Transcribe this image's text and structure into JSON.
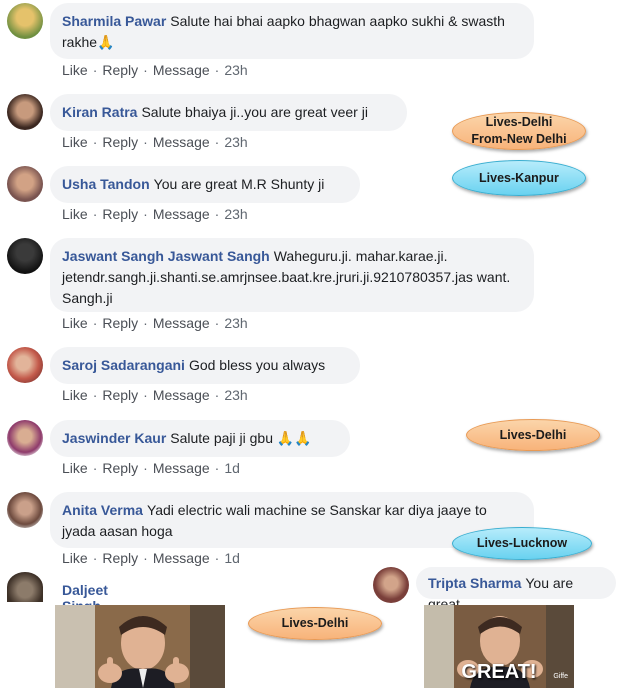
{
  "comments": [
    {
      "name": "Sharmila Pawar",
      "text": "Salute hai bhai aapko bhagwan aapko sukhi & swasth rakhe",
      "emoji": "🙏",
      "time": "23h"
    },
    {
      "name": "Kiran Ratra",
      "text": "Salute bhaiya ji..you are great veer ji",
      "time": "23h"
    },
    {
      "name": "Usha Tandon",
      "text": "You are great M.R Shunty ji",
      "time": "23h"
    },
    {
      "name": "Jaswant Sangh Jaswant Sangh",
      "text": "Waheguru.ji. mahar.karae.ji. jetendr.sangh.ji.shanti.se.amrjnsee.baat.kre.jruri.ji.9210780357.jas want. Sangh.ji",
      "time": "23h"
    },
    {
      "name": "Saroj Sadarangani",
      "text": "God bless you always",
      "time": "23h"
    },
    {
      "name": "Jaswinder Kaur",
      "text": "Salute paji ji gbu",
      "emoji": "🙏🙏",
      "time": "1d"
    },
    {
      "name": "Anita Verma",
      "text": "Yadi electric wali machine se Sanskar kar diya jaaye to jyada aasan hoga",
      "time": "1d"
    },
    {
      "name": "Daljeet Singh"
    },
    {
      "name": "Tripta Sharma",
      "text": "You are great"
    }
  ],
  "actions": {
    "like": "Like",
    "reply": "Reply",
    "message": "Message",
    "sep": "·"
  },
  "tags": [
    {
      "line1": "Lives-Delhi",
      "line2": "From-New Delhi",
      "color": "orange"
    },
    {
      "line1": "Lives-Kanpur",
      "color": "blue"
    },
    {
      "line1": "Lives-Delhi",
      "color": "orange"
    },
    {
      "line1": "Lives-Lucknow",
      "color": "blue"
    },
    {
      "line1": "Lives-Delhi",
      "color": "orange"
    }
  ],
  "gifs": [
    {
      "caption": ""
    },
    {
      "caption": "GREAT!",
      "watermark": "Giffe"
    }
  ],
  "colors": {
    "name_link": "#385898",
    "bubble_bg": "#f2f3f5",
    "tag_orange": "#f8b37a",
    "tag_blue": "#69d2f0"
  }
}
